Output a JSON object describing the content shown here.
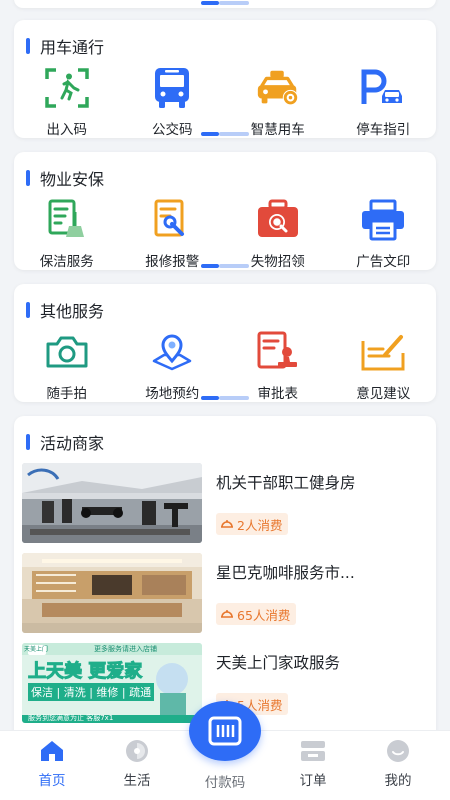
{
  "sections": {
    "travel": {
      "title": "用车通行",
      "items": [
        "出入码",
        "公交码",
        "智慧用车",
        "停车指引"
      ]
    },
    "property": {
      "title": "物业安保",
      "items": [
        "保洁服务",
        "报修报警",
        "失物招领",
        "广告文印"
      ]
    },
    "other": {
      "title": "其他服务",
      "items": [
        "随手拍",
        "场地预约",
        "审批表",
        "意见建议"
      ]
    },
    "merchants": {
      "title": "活动商家",
      "list": [
        {
          "name": "机关干部职工健身房",
          "badge": "2人消费"
        },
        {
          "name": "星巴克咖啡服务市...",
          "badge": "65人消费"
        },
        {
          "name": "天美上门家政服务",
          "badge": "5人消费"
        }
      ],
      "ad_text": {
        "top": "更多服务请进入店铺",
        "main": "上天美 更爱家",
        "services": "保洁 | 清洗 | 维修 | 疏通",
        "bottom": "服务到您满意为止 客服7x1",
        "logo": "天美上门"
      }
    }
  },
  "tabbar": {
    "home": "首页",
    "life": "生活",
    "pay": "付款码",
    "orders": "订单",
    "mine": "我的"
  },
  "colors": {
    "primary": "#2e6cf6",
    "green": "#2fa75a",
    "red": "#e24a3b",
    "orange": "#f0a020",
    "teal": "#1f9a82"
  }
}
